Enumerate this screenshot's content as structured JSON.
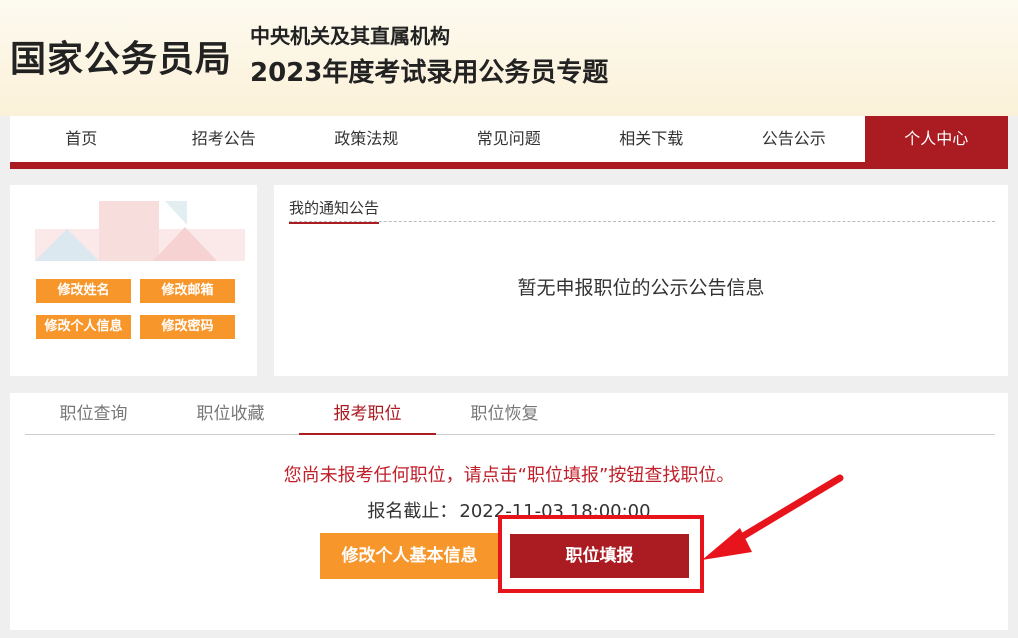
{
  "header": {
    "logo": "国家公务员局",
    "subtitle": "中央机关及其直属机构",
    "title": "2023年度考试录用公务员专题"
  },
  "nav": {
    "items": [
      "首页",
      "招考公告",
      "政策法规",
      "常见问题",
      "相关下载",
      "公告公示",
      "个人中心"
    ],
    "active": "个人中心"
  },
  "profile": {
    "buttons": [
      "修改姓名",
      "修改邮箱",
      "修改个人信息",
      "修改密码"
    ]
  },
  "notice": {
    "tab": "我的通知公告",
    "empty": "暂无申报职位的公示公告信息"
  },
  "jobs": {
    "tabs": [
      "职位查询",
      "职位收藏",
      "报考职位",
      "职位恢复"
    ],
    "active_tab": "报考职位",
    "message": "您尚未报考任何职位，请点击“职位填报”按钮查找职位。",
    "deadline_label": "报名截止：",
    "deadline_value": "2022-11-03 18:00:00",
    "edit_button": "修改个人基本信息",
    "fill_button": "职位填报"
  },
  "colors": {
    "brand_red": "#ab1b22",
    "orange": "#f7962b",
    "highlight_red": "#e8141c"
  }
}
